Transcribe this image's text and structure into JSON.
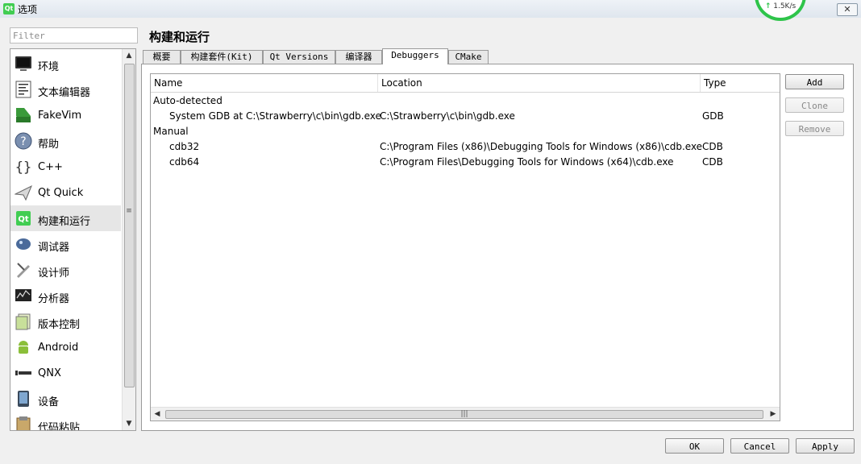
{
  "window": {
    "title": "选项",
    "close_glyph": "✕",
    "net_speed": "1.5K/s"
  },
  "filter": {
    "placeholder": "Filter",
    "value": ""
  },
  "sidebar": {
    "items": [
      {
        "label": "环境",
        "icon": "monitor-icon"
      },
      {
        "label": "文本编辑器",
        "icon": "text-editor-icon"
      },
      {
        "label": "FakeVim",
        "icon": "fakevim-icon"
      },
      {
        "label": "帮助",
        "icon": "help-icon"
      },
      {
        "label": "C++",
        "icon": "cpp-braces-icon"
      },
      {
        "label": "Qt Quick",
        "icon": "qt-quick-icon"
      },
      {
        "label": "构建和运行",
        "icon": "build-run-icon",
        "selected": true
      },
      {
        "label": "调试器",
        "icon": "debugger-icon"
      },
      {
        "label": "设计师",
        "icon": "designer-icon"
      },
      {
        "label": "分析器",
        "icon": "analyzer-icon"
      },
      {
        "label": "版本控制",
        "icon": "version-control-icon"
      },
      {
        "label": "Android",
        "icon": "android-icon"
      },
      {
        "label": "QNX",
        "icon": "qnx-icon"
      },
      {
        "label": "设备",
        "icon": "device-icon"
      },
      {
        "label": "代码粘贴",
        "icon": "code-paste-icon"
      }
    ]
  },
  "page": {
    "title": "构建和运行"
  },
  "tabs": [
    {
      "label": "概要"
    },
    {
      "label": "构建套件(Kit)"
    },
    {
      "label": "Qt Versions"
    },
    {
      "label": "编译器"
    },
    {
      "label": "Debuggers",
      "active": true
    },
    {
      "label": "CMake"
    }
  ],
  "table": {
    "columns": [
      "Name",
      "Location",
      "Type"
    ],
    "rows": [
      {
        "name": "Auto-detected",
        "location": "",
        "type": "",
        "group": true
      },
      {
        "name": "System GDB at C:\\Strawberry\\c\\bin\\gdb.exe",
        "location": "C:\\Strawberry\\c\\bin\\gdb.exe",
        "type": "GDB"
      },
      {
        "name": "Manual",
        "location": "",
        "type": "",
        "group": true
      },
      {
        "name": "cdb32",
        "location": "C:\\Program Files (x86)\\Debugging Tools for Windows (x86)\\cdb.exe",
        "type": "CDB"
      },
      {
        "name": "cdb64",
        "location": "C:\\Program Files\\Debugging Tools for Windows (x64)\\cdb.exe",
        "type": "CDB"
      }
    ]
  },
  "side_buttons": {
    "add": "Add",
    "clone": "Clone",
    "remove": "Remove"
  },
  "dialog_buttons": {
    "ok": "OK",
    "cancel": "Cancel",
    "apply": "Apply"
  },
  "colors": {
    "accent_green": "#41cd52",
    "net_ring": "#2ec44a",
    "selected_bg": "#e6e6e6"
  }
}
